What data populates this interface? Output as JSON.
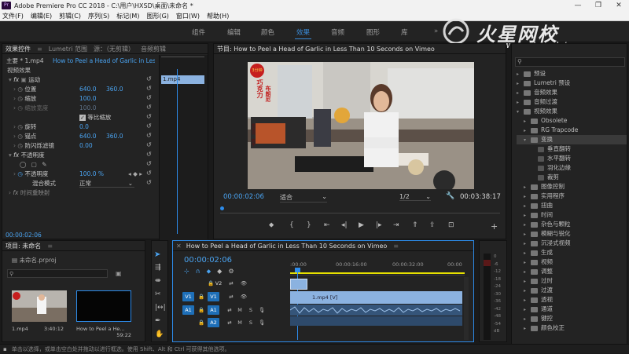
{
  "window": {
    "title": "Adobe Premiere Pro CC 2018 - C:\\用户\\HXSD\\桌面\\未命名 *",
    "min": "—",
    "max": "❐",
    "close": "✕"
  },
  "menu": [
    "文件(F)",
    "编辑(E)",
    "剪辑(C)",
    "序列(S)",
    "标记(M)",
    "图形(G)",
    "窗口(W)",
    "帮助(H)"
  ],
  "workspaces": [
    "组件",
    "编辑",
    "颜色",
    "效果",
    "音频",
    "图形",
    "库"
  ],
  "active_workspace": "效果",
  "watermark": {
    "brand": "火星网校",
    "url": "www.hxsd.tv"
  },
  "effect_controls": {
    "tabs": [
      "效果控件",
      "Lumetri 范围",
      "源：（无剪辑）",
      "音频剪辑"
    ],
    "master": "主要 * 1.mp4",
    "clip": "How to Peel a Head of Garlic in Less ...",
    "video_effects": "视频效果",
    "motion": "运动",
    "position": {
      "label": "位置",
      "x": "640.0",
      "y": "360.0"
    },
    "scale": {
      "label": "缩放",
      "v": "100.0"
    },
    "scale_width": {
      "label": "缩放宽度",
      "v": "100.0"
    },
    "uniform": "等比缩放",
    "rotation": {
      "label": "旋转",
      "v": "0.0"
    },
    "anchor": {
      "label": "锚点",
      "x": "640.0",
      "y": "360.0"
    },
    "flicker": {
      "label": "防闪烁滤镜",
      "v": "0.00"
    },
    "opacity": "不透明度",
    "opacity_val": {
      "label": "不透明度",
      "v": "100.0 %"
    },
    "blend": {
      "label": "混合模式",
      "v": "正常"
    },
    "remap": "时间重映射",
    "mini_clip": "1.mp4",
    "timecode": "00:00:02:06"
  },
  "program": {
    "title": "节目: How to Peel a Head of Garlic in Less Than 10 Seconds on Vimeo",
    "tc": "00:00:02:06",
    "fit": "适合",
    "res": "1/2",
    "dur": "00:03:38:17",
    "overlay": {
      "badge": "3分钟",
      "lines": [
        "巧克力",
        "布朗尼"
      ],
      "sub": "烘焙师 · 教学"
    }
  },
  "project": {
    "tabs": [
      "项目: 未命名"
    ],
    "file": "未命名.prproj",
    "items": [
      {
        "name": "1.mp4",
        "dur": "3:40:12"
      },
      {
        "name": "How to Peel a He...",
        "dur": "59:22"
      }
    ]
  },
  "timeline": {
    "title": "How to Peel a Head of Garlic in Less Than 10 Seconds on Vimeo",
    "tc": "00:00:02:06",
    "ruler": [
      ":00:00",
      "00:00:16:00",
      "00:00:32:00",
      "00:00"
    ],
    "tracks": [
      {
        "id": "V2"
      },
      {
        "id": "V1",
        "src": "V1"
      },
      {
        "id": "A1",
        "src": "A1"
      },
      {
        "id": "A2"
      }
    ],
    "clip_label": "1.mp4 [V]"
  },
  "effects_panel": {
    "items": [
      {
        "d": 0,
        "label": "预设",
        "t": "▸"
      },
      {
        "d": 0,
        "label": "Lumetri 预设",
        "t": "▸"
      },
      {
        "d": 0,
        "label": "音频效果",
        "t": "▸"
      },
      {
        "d": 0,
        "label": "音频过渡",
        "t": "▸"
      },
      {
        "d": 0,
        "label": "视频效果",
        "t": "▾"
      },
      {
        "d": 1,
        "label": "Obsolete",
        "t": "▸"
      },
      {
        "d": 1,
        "label": "RG Trapcode",
        "t": "▸"
      },
      {
        "d": 1,
        "label": "变换",
        "t": "▾",
        "sel": true
      },
      {
        "d": 2,
        "label": "垂直翻转",
        "t": ""
      },
      {
        "d": 2,
        "label": "水平翻转",
        "t": ""
      },
      {
        "d": 2,
        "label": "羽化边缘",
        "t": ""
      },
      {
        "d": 2,
        "label": "裁剪",
        "t": ""
      },
      {
        "d": 1,
        "label": "图像控制",
        "t": "▸"
      },
      {
        "d": 1,
        "label": "实用程序",
        "t": "▸"
      },
      {
        "d": 1,
        "label": "扭曲",
        "t": "▸"
      },
      {
        "d": 1,
        "label": "时间",
        "t": "▸"
      },
      {
        "d": 1,
        "label": "杂色与颗粒",
        "t": "▸"
      },
      {
        "d": 1,
        "label": "模糊与锐化",
        "t": "▸"
      },
      {
        "d": 1,
        "label": "沉浸式视频",
        "t": "▸"
      },
      {
        "d": 1,
        "label": "生成",
        "t": "▸"
      },
      {
        "d": 1,
        "label": "视频",
        "t": "▸"
      },
      {
        "d": 1,
        "label": "调整",
        "t": "▸"
      },
      {
        "d": 1,
        "label": "过时",
        "t": "▸"
      },
      {
        "d": 1,
        "label": "过渡",
        "t": "▸"
      },
      {
        "d": 1,
        "label": "透视",
        "t": "▸"
      },
      {
        "d": 1,
        "label": "通道",
        "t": "▸"
      },
      {
        "d": 1,
        "label": "键控",
        "t": "▸"
      },
      {
        "d": 1,
        "label": "颜色校正",
        "t": "▸"
      }
    ]
  },
  "meter": {
    "labels": [
      "0",
      "-6",
      "-12",
      "-18",
      "-24",
      "-30",
      "-36",
      "-42",
      "-48",
      "-54",
      "dB"
    ]
  },
  "status": "单击以选择，或单击空白处并拖动以进行框选。使用 Shift、Alt 和 Ctrl 可获得其他选项。",
  "colors": {
    "accent": "#2d8ceb",
    "clip": "#8bb2e0",
    "audio": "#35557a",
    "track_src": "#1e6fb8"
  }
}
